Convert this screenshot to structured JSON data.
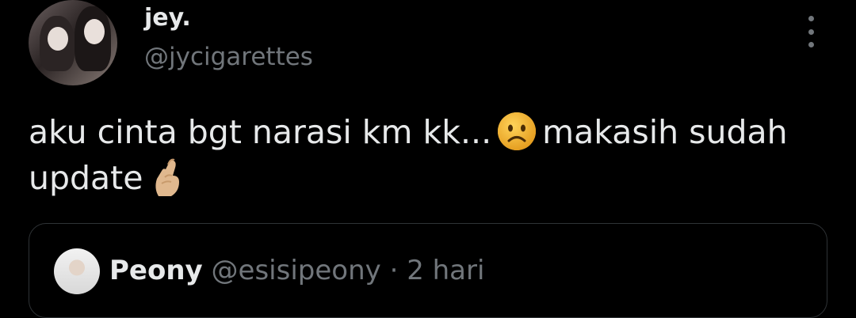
{
  "tweet": {
    "author": {
      "display_name": "jey.",
      "handle": "@jycigarettes"
    },
    "text_part1": "aku cinta bgt narasi km kk...",
    "text_part2": "makasih sudah update",
    "emojis": [
      "frowning-face",
      "crossed-fingers-light-skin"
    ]
  },
  "quoted_tweet": {
    "author": {
      "display_name": "Peony",
      "handle": "@esisipeony"
    },
    "separator": "·",
    "time": "2 hari"
  },
  "colors": {
    "background": "#000000",
    "text": "#e7e9ea",
    "secondary": "#71767b",
    "border": "#2f3336"
  }
}
